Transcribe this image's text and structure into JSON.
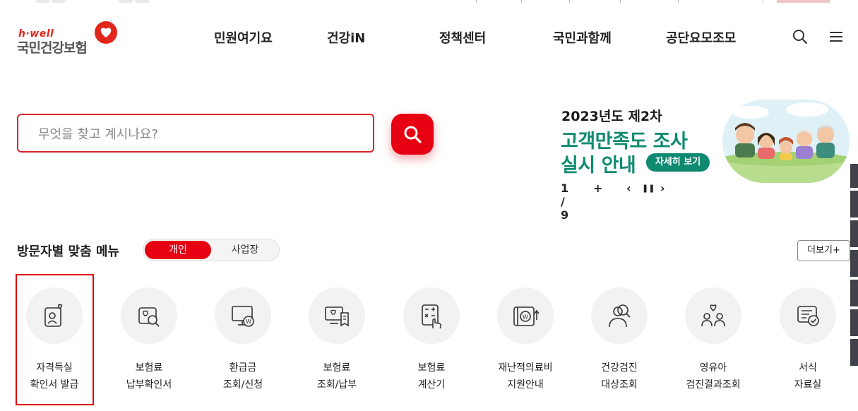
{
  "logo": {
    "tagline": "h·well",
    "name": "국민건강보험"
  },
  "nav": {
    "items": [
      "민원여기요",
      "건강iN",
      "정책센터",
      "국민과함께",
      "공단요모조모"
    ]
  },
  "header_icons": [
    "search-icon",
    "hamburger-menu-icon"
  ],
  "search": {
    "placeholder": "무엇을 찾고 계시나요?",
    "value": ""
  },
  "banner": {
    "line1": "2023년도 제2차",
    "line2": "고객만족도 조사",
    "line3": "실시 안내",
    "button": "자세히 보기",
    "pager": "1 / 9",
    "controls": {
      "add": "+",
      "prev": "‹",
      "pause": "❚❚",
      "next": "›"
    }
  },
  "section": {
    "title": "방문자별 맞춤 메뉴",
    "tabs": [
      "개인",
      "사업장"
    ],
    "active_tab": "개인",
    "more": "더보기+"
  },
  "menu": [
    {
      "line1": "자격득실",
      "line2": "확인서 발급",
      "icon": "id-card-heart-icon",
      "highlighted": true
    },
    {
      "line1": "보험료",
      "line2": "납부확인서",
      "icon": "document-search-icon"
    },
    {
      "line1": "환급금",
      "line2": "조회/신청",
      "icon": "monitor-won-icon"
    },
    {
      "line1": "보험료",
      "line2": "조회/납부",
      "icon": "monitor-receipt-icon"
    },
    {
      "line1": "보험료",
      "line2": "계산기",
      "icon": "calculator-icon"
    },
    {
      "line1": "재난적의료비",
      "line2": "지원안내",
      "icon": "card-won-icon"
    },
    {
      "line1": "건강검진",
      "line2": "대상조회",
      "icon": "person-search-icon"
    },
    {
      "line1": "영유아",
      "line2": "검진결과조회",
      "icon": "family-heart-icon"
    },
    {
      "line1": "서식",
      "line2": "자료실",
      "icon": "form-check-icon"
    }
  ],
  "colors": {
    "brand_red": "#e60012",
    "banner_green": "#0e8a70",
    "text": "#222222"
  }
}
